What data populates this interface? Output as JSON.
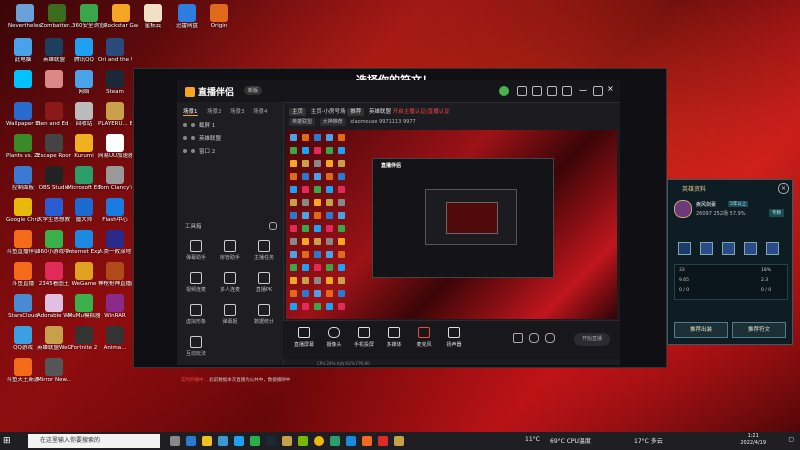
{
  "desktop_icons": [
    {
      "label": "Nevertheless",
      "color": "#6aa2d8"
    },
    {
      "label": "Zombatter...",
      "color": "#3c6b1e"
    },
    {
      "label": "360安全浏览器",
      "color": "#3aa64a"
    },
    {
      "label": "Rockstar Games...",
      "color": "#f5a623"
    },
    {
      "label": "星标云",
      "color": "#f0e0c8"
    },
    {
      "label": "迅雷网盘",
      "color": "#2d7de0"
    },
    {
      "label": "Origin",
      "color": "#e06a1c"
    },
    {
      "label": "此电脑",
      "color": "#4aa3e8"
    },
    {
      "label": "英雄联盟",
      "color": "#1d3e5c"
    },
    {
      "label": "腾讯QQ",
      "color": "#1da1f2"
    },
    {
      "label": "Ori and the Will of...",
      "color": "#2a4a7a"
    },
    {
      "label": "",
      "color": "#00c3ff"
    },
    {
      "label": "",
      "color": "#d88"
    },
    {
      "label": "网络",
      "color": "#4aa3e8"
    },
    {
      "label": "Steam",
      "color": "#1b2838"
    },
    {
      "label": "Wallpaper Engine",
      "color": "#2a6acb"
    },
    {
      "label": "Ben and Ed - Blood P...",
      "color": "#8a1a1a"
    },
    {
      "label": "回收站",
      "color": "#bbbbbb"
    },
    {
      "label": "PLAYERU... BATTLEGR...",
      "color": "#c8a04a"
    },
    {
      "label": "Plants vs. Zombies G...",
      "color": "#3a8a2a"
    },
    {
      "label": "Escape Room - T...",
      "color": "#444"
    },
    {
      "label": "Kurumi",
      "color": "#f0b020"
    },
    {
      "label": "网易UU加速器",
      "color": "#ffffff"
    },
    {
      "label": "控制面板",
      "color": "#3a7ad0"
    },
    {
      "label": "OBS Studio",
      "color": "#222"
    },
    {
      "label": "Microsoft Edge",
      "color": "#2a9d6a"
    },
    {
      "label": "Tom Clancy's...",
      "color": "#999"
    },
    {
      "label": "Google Chrome",
      "color": "#e8b80c"
    },
    {
      "label": "大学生思想教育.docx",
      "color": "#2a5bd0"
    },
    {
      "label": "魔大师",
      "color": "#1a6ad0"
    },
    {
      "label": "Flash中心",
      "color": "#1a7ae0"
    },
    {
      "label": "斗鱼直播伴侣",
      "color": "#f26a1a"
    },
    {
      "label": "360小游戏中心",
      "color": "#3ab04a"
    },
    {
      "label": "Internet Explorer",
      "color": "#1a8ae0"
    },
    {
      "label": "人类一败涂地 Human Fa...",
      "color": "#2a2a8a"
    },
    {
      "label": "斗鱼直播",
      "color": "#f26a1a"
    },
    {
      "label": "2345看图王",
      "color": "#e02a5a"
    },
    {
      "label": "WeGame",
      "color": "#e0a020"
    },
    {
      "label": "神枪枪神直播间",
      "color": "#b04a1a"
    },
    {
      "label": "StarsCloud",
      "color": "#4a8ad0"
    },
    {
      "label": "Adorable Witch",
      "color": "#e0c0e0"
    },
    {
      "label": "MuMu模拟器",
      "color": "#3ab04a"
    },
    {
      "label": "WinRAR",
      "color": "#8a2a8a"
    },
    {
      "label": "QQ游戏",
      "color": "#3aa0e0"
    },
    {
      "label": "英雄联盟WeGame版",
      "color": "#c8a04a"
    },
    {
      "label": "Fortnite 2",
      "color": "#333"
    },
    {
      "label": "Anima...",
      "color": "#333"
    },
    {
      "label": "斗鱼天王新游",
      "color": "#f26a1a"
    },
    {
      "label": "Mirror New...",
      "color": "#555"
    }
  ],
  "overlay_title": "选择你的符文！",
  "app": {
    "name": "直播伴侣",
    "version": "新版",
    "scene_tabs": [
      "场景1",
      "场景2",
      "场景3",
      "场景4"
    ],
    "sources": [
      {
        "label": "截屏 1"
      },
      {
        "label": "英雄联盟"
      },
      {
        "label": "窗口 2"
      }
    ],
    "tools_label": "工具箱",
    "tools": [
      {
        "label": "弹幕助手"
      },
      {
        "label": "房管助手"
      },
      {
        "label": "主播任务"
      },
      {
        "label": "视频连麦"
      },
      {
        "label": "多人连麦"
      },
      {
        "label": "直播PK"
      },
      {
        "label": "虚拟形象"
      },
      {
        "label": "弹幕姬"
      },
      {
        "label": "数据统计"
      },
      {
        "label": "互动玩法"
      }
    ],
    "info_row1": {
      "tag1": "主页",
      "text1": "主页·小房号场",
      "tag2": "推荐",
      "text2": "英雄联盟",
      "link": "开启主播认证/直播认证"
    },
    "info_row2": {
      "tag1": "英雄联盟",
      "tag2": "大神推荐",
      "name": "xlaomouse",
      "id": "9971113",
      "views": "9977"
    },
    "bottom_buttons": [
      {
        "label": "直播屏幕"
      },
      {
        "label": "摄像头"
      },
      {
        "label": "手机投屏"
      },
      {
        "label": "多媒体"
      },
      {
        "label": "麦克风"
      },
      {
        "label": "扬声器"
      }
    ],
    "start_live": "开始直播",
    "status_text": "实时开播中...",
    "status_note": "此前数据本次直播为公共中，数据播映中",
    "stats": "CPU:24%  内存:62%  FPS:60"
  },
  "hero_card": {
    "title": "英雄资料",
    "name": "疾风剑豪",
    "badge": "5年以上",
    "games": "26097",
    "games_count": "252场",
    "winrate": "57.9%",
    "tag": "专精",
    "stat_rows": [
      [
        "33",
        "18%"
      ],
      [
        "9.65",
        "2.3"
      ],
      [
        "0 / 0",
        "0 / 0"
      ]
    ],
    "btn_left": "推荐出装",
    "btn_right": "推荐符文"
  },
  "taskbar": {
    "search_placeholder": "在这里输入你要搜索的",
    "weather1": "11°C",
    "cpu": "69°C CPU温度",
    "weather2": "17°C 多云",
    "time": "1:21",
    "date": "2022/4/19"
  }
}
